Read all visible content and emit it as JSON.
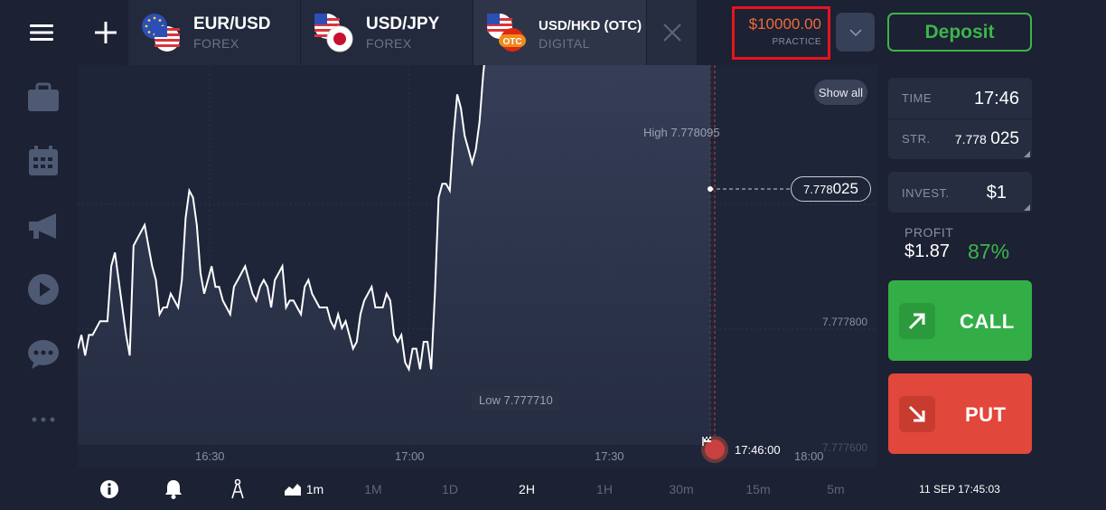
{
  "tabs": [
    {
      "title": "EUR/USD",
      "sub": "FOREX"
    },
    {
      "title": "USD/JPY",
      "sub": "FOREX"
    },
    {
      "title": "USD/HKD (OTC)",
      "sub": "DIGITAL",
      "badge": "OTC"
    }
  ],
  "balance": {
    "amount": "$10000.00",
    "mode": "PRACTICE",
    "accent": "#ef6a3b",
    "highlight": "#e8141d"
  },
  "deposit_label": "Deposit",
  "chart": {
    "show_all": "Show all",
    "high_label": "High 7.778095",
    "low_label": "Low 7.777710",
    "current_price_main": "7.778",
    "current_price_tail": "025",
    "y_tick_1": "7.777800",
    "y_tick_2": "7.777600",
    "x_ticks": [
      "16:30",
      "17:00",
      "17:30",
      "18:00"
    ],
    "expiry_time": "17:46:00"
  },
  "chart_data": {
    "type": "area",
    "series": [
      {
        "values": [
          7.77774,
          7.77776,
          7.77773,
          7.77776,
          7.77776,
          7.77777,
          7.77778,
          7.77778,
          7.77778,
          7.77786,
          7.77788,
          7.77784,
          7.7778,
          7.77776,
          7.77773,
          7.77789,
          7.7779,
          7.77791,
          7.77792,
          7.77789,
          7.77786,
          7.77784,
          7.77779,
          7.7778,
          7.7778,
          7.77782,
          7.77781,
          7.7778,
          7.77784,
          7.77793,
          7.77797,
          7.77796,
          7.77792,
          7.77785,
          7.77782,
          7.77784,
          7.77786,
          7.77783,
          7.77783,
          7.77781,
          7.7778,
          7.77779,
          7.77783,
          7.77784,
          7.77785,
          7.77786,
          7.77784,
          7.77782,
          7.77781,
          7.77783,
          7.77784,
          7.77783,
          7.7778,
          7.77784,
          7.77785,
          7.77786,
          7.7778,
          7.77781,
          7.77781,
          7.7778,
          7.77779,
          7.77783,
          7.77784,
          7.77782,
          7.77781,
          7.7778,
          7.7778,
          7.7778,
          7.77778,
          7.77777,
          7.77779,
          7.77777,
          7.77778,
          7.77776,
          7.77774,
          7.77775,
          7.77779,
          7.77781,
          7.77782,
          7.77783,
          7.7778,
          7.7778,
          7.7778,
          7.77782,
          7.77781,
          7.77776,
          7.77775,
          7.77776,
          7.77772,
          7.77771,
          7.77774,
          7.77774,
          7.77771,
          7.77775,
          7.77775,
          7.77771,
          7.77782,
          7.77796,
          7.77798,
          7.77798,
          7.77797,
          7.77805,
          7.77811,
          7.77809,
          7.77805,
          7.77803,
          7.77801,
          7.77803,
          7.77807,
          7.77814,
          7.77819,
          7.77827,
          7.77834,
          7.77838,
          7.77835,
          7.77836,
          7.77836,
          7.7784,
          7.77843,
          7.77841,
          7.7784,
          7.77843,
          7.7785,
          7.77853,
          7.77852,
          7.77849,
          7.77846,
          7.77852,
          7.77848,
          7.7785,
          7.77848,
          7.77852,
          7.77863,
          7.7787,
          7.77871,
          7.77879,
          7.7788,
          7.77889,
          7.77888,
          7.77887,
          7.77883,
          7.77894,
          7.77897,
          7.77895,
          7.77893,
          7.7789,
          7.77893,
          7.7788,
          7.7788,
          7.77881,
          7.77878,
          7.77875,
          7.77869,
          7.7787,
          7.77874,
          7.77865,
          7.77867,
          7.77869,
          7.77865,
          7.77862,
          7.77863,
          7.77866,
          7.77869,
          7.77872,
          7.77878,
          7.77885,
          7.77889,
          7.7789,
          7.77889,
          7.77885,
          7.77883
        ]
      }
    ],
    "ylim": [
      7.7776,
      7.77815
    ],
    "x_labels": [
      "16:30",
      "17:00",
      "17:30",
      "18:00"
    ]
  },
  "panel": {
    "time_label": "TIME",
    "time_value": "17:46",
    "strike_label": "STR.",
    "strike_main": "7.778",
    "strike_tail": "025",
    "invest_label": "INVEST.",
    "invest_value": "$1",
    "profit_label": "PROFIT",
    "profit_value": "$1.87",
    "profit_pct": "87%"
  },
  "call_label": "CALL",
  "put_label": "PUT",
  "bottom": {
    "timeframe": "1m",
    "periods": [
      "1M",
      "1D",
      "2H",
      "1H",
      "30m",
      "15m",
      "5m"
    ],
    "active_period": "2H",
    "datetime": "11 SEP 17:45:03"
  }
}
